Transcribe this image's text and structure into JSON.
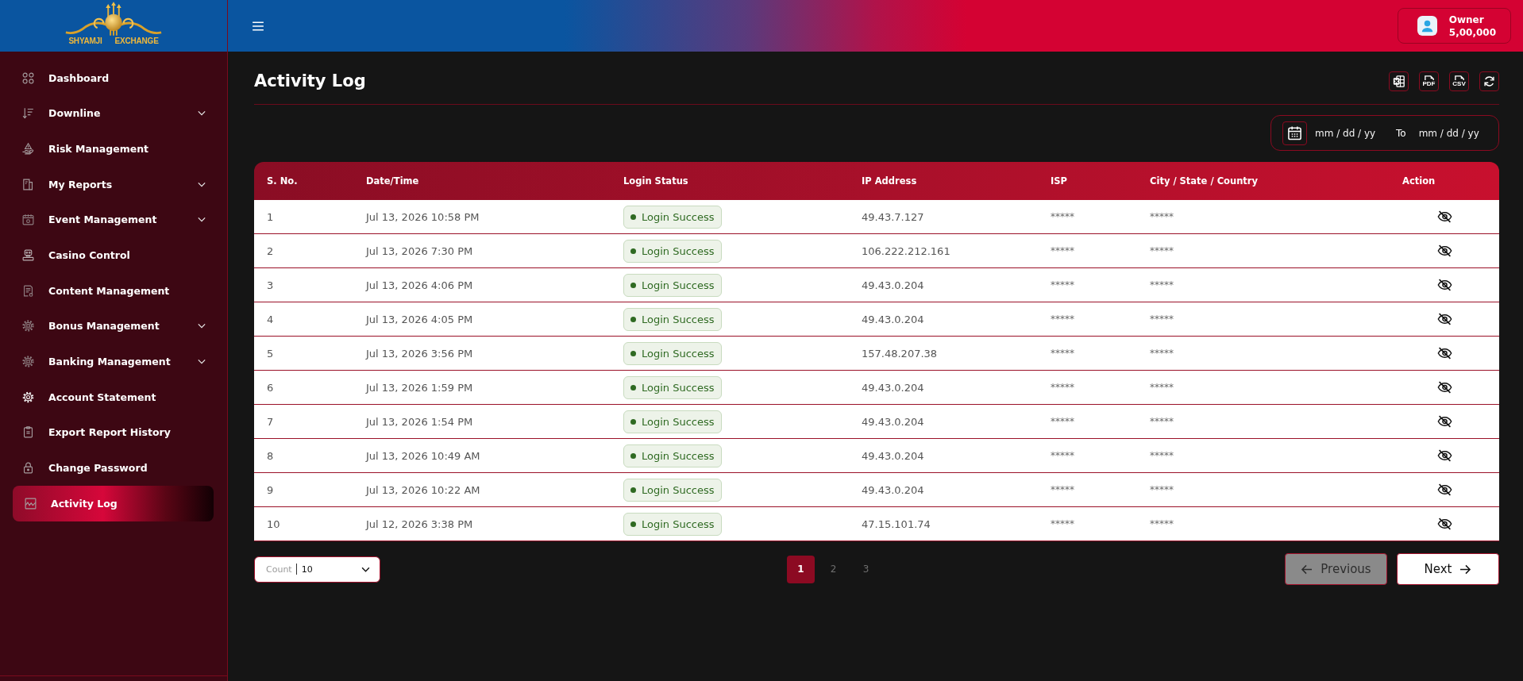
{
  "logo": {
    "left_text": "SHYAMJI",
    "right_text": "EXCHANGE"
  },
  "sidebar": {
    "items": [
      {
        "label": "Dashboard",
        "expandable": false,
        "selected": false
      },
      {
        "label": "Downline",
        "expandable": true,
        "selected": false
      },
      {
        "label": "Risk Management",
        "expandable": false,
        "selected": false
      },
      {
        "label": "My Reports",
        "expandable": true,
        "selected": false
      },
      {
        "label": "Event Management",
        "expandable": true,
        "selected": false
      },
      {
        "label": "Casino Control",
        "expandable": false,
        "selected": false
      },
      {
        "label": "Content Management",
        "expandable": false,
        "selected": false
      },
      {
        "label": "Bonus Management",
        "expandable": true,
        "selected": false
      },
      {
        "label": "Banking Management",
        "expandable": true,
        "selected": false
      },
      {
        "label": "Account Statement",
        "expandable": false,
        "selected": false
      },
      {
        "label": "Export Report History",
        "expandable": false,
        "selected": false
      },
      {
        "label": "Change Password",
        "expandable": false,
        "selected": false
      },
      {
        "label": "Activity Log",
        "expandable": false,
        "selected": true
      }
    ]
  },
  "header": {
    "account": {
      "role": "Owner",
      "balance": "5,00,000"
    }
  },
  "page": {
    "title": "Activity Log",
    "toolbar": [
      {
        "kind": "excel"
      },
      {
        "kind": "pdf",
        "label": "PDF"
      },
      {
        "kind": "csv",
        "label": "CSV"
      },
      {
        "kind": "refresh"
      }
    ]
  },
  "date_range": {
    "from": {
      "placeholder": "mm / dd / yy"
    },
    "separator": "To",
    "to": {
      "placeholder": "mm / dd / yy"
    }
  },
  "table": {
    "columns": [
      "S. No.",
      "Date/Time",
      "Login Status",
      "IP Address",
      "ISP",
      "City / State / Country",
      "Action"
    ],
    "rows": [
      {
        "s_no": "1",
        "date_time": "Jul 13, 2026 10:58 PM",
        "login_status": "Login Success",
        "ip_address": "49.43.7.127",
        "isp": "*****",
        "location": "*****"
      },
      {
        "s_no": "2",
        "date_time": "Jul 13, 2026 7:30 PM",
        "login_status": "Login Success",
        "ip_address": "106.222.212.161",
        "isp": "*****",
        "location": "*****"
      },
      {
        "s_no": "3",
        "date_time": "Jul 13, 2026 4:06 PM",
        "login_status": "Login Success",
        "ip_address": "49.43.0.204",
        "isp": "*****",
        "location": "*****"
      },
      {
        "s_no": "4",
        "date_time": "Jul 13, 2026 4:05 PM",
        "login_status": "Login Success",
        "ip_address": "49.43.0.204",
        "isp": "*****",
        "location": "*****"
      },
      {
        "s_no": "5",
        "date_time": "Jul 13, 2026 3:56 PM",
        "login_status": "Login Success",
        "ip_address": "157.48.207.38",
        "isp": "*****",
        "location": "*****"
      },
      {
        "s_no": "6",
        "date_time": "Jul 13, 2026 1:59 PM",
        "login_status": "Login Success",
        "ip_address": "49.43.0.204",
        "isp": "*****",
        "location": "*****"
      },
      {
        "s_no": "7",
        "date_time": "Jul 13, 2026 1:54 PM",
        "login_status": "Login Success",
        "ip_address": "49.43.0.204",
        "isp": "*****",
        "location": "*****"
      },
      {
        "s_no": "8",
        "date_time": "Jul 13, 2026 10:49 AM",
        "login_status": "Login Success",
        "ip_address": "49.43.0.204",
        "isp": "*****",
        "location": "*****"
      },
      {
        "s_no": "9",
        "date_time": "Jul 13, 2026 10:22 AM",
        "login_status": "Login Success",
        "ip_address": "49.43.0.204",
        "isp": "*****",
        "location": "*****"
      },
      {
        "s_no": "10",
        "date_time": "Jul 12, 2026 3:38 PM",
        "login_status": "Login Success",
        "ip_address": "47.15.101.74",
        "isp": "*****",
        "location": "*****"
      }
    ]
  },
  "pagination": {
    "count": {
      "label": "Count",
      "value": "10"
    },
    "pages": [
      {
        "label": "1",
        "selected": true
      },
      {
        "label": "2",
        "selected": false
      },
      {
        "label": "3",
        "selected": false
      }
    ],
    "previous": {
      "label": "Previous",
      "disabled": true
    },
    "next": {
      "label": "Next",
      "disabled": false
    }
  }
}
